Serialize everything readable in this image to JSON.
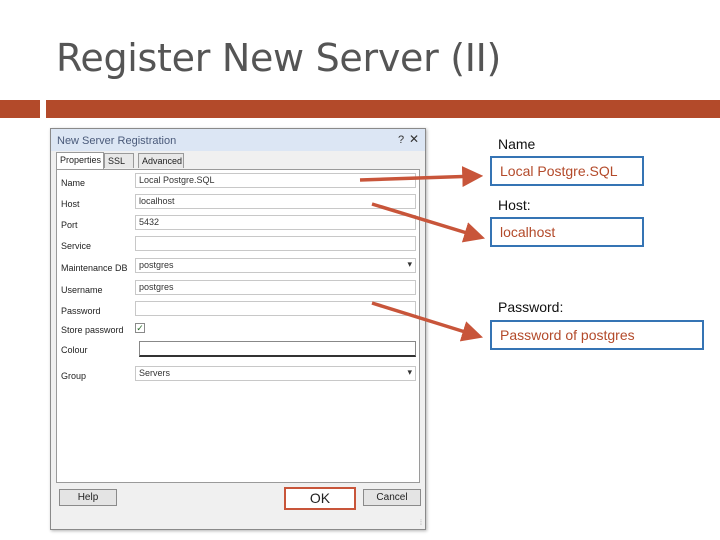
{
  "slide": {
    "title": "Register New Server (II)",
    "accent_color": "#b34a2a"
  },
  "dialog": {
    "title": "New Server Registration",
    "help_glyph": "?",
    "close_glyph": "✕",
    "tabs": [
      {
        "label": "Properties",
        "active": true
      },
      {
        "label": "SSL",
        "active": false
      },
      {
        "label": "Advanced",
        "active": false
      }
    ],
    "fields": {
      "name": {
        "label": "Name",
        "value": "Local Postgre.SQL"
      },
      "host": {
        "label": "Host",
        "value": "localhost"
      },
      "port": {
        "label": "Port",
        "value": "5432"
      },
      "service": {
        "label": "Service",
        "value": ""
      },
      "maintenance_db": {
        "label": "Maintenance DB",
        "value": "postgres"
      },
      "username": {
        "label": "Username",
        "value": "postgres"
      },
      "password": {
        "label": "Password",
        "value": ""
      },
      "store_password": {
        "label": "Store password",
        "checked": true,
        "check_glyph": "✓"
      },
      "colour": {
        "label": "Colour",
        "value": ""
      },
      "group": {
        "label": "Group",
        "value": "Servers"
      }
    },
    "buttons": {
      "help": "Help",
      "ok": "OK",
      "cancel": "Cancel"
    },
    "grip_glyph": "⁞"
  },
  "callouts": {
    "name": {
      "label": "Name",
      "value": "Local Postgre.SQL"
    },
    "host": {
      "label": "Host:",
      "value": "localhost"
    },
    "password": {
      "label": "Password:",
      "value": "Password of postgres"
    },
    "box_color": "#3574b4",
    "arrow_color": "#c8553a"
  }
}
